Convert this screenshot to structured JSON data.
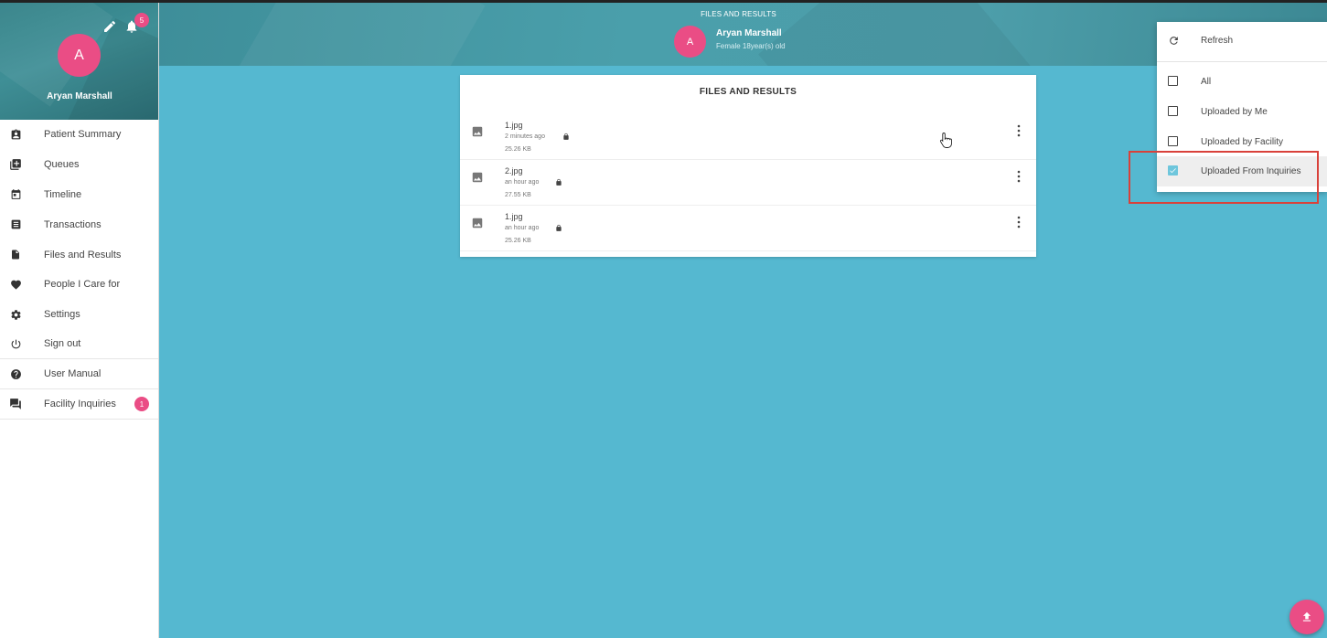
{
  "header": {
    "title": "FILES AND RESULTS",
    "avatar_letter": "A",
    "patient_name": "Aryan Marshall",
    "patient_info": "Female 18year(s) old"
  },
  "sidebar": {
    "avatar_letter": "A",
    "user_name": "Aryan Marshall",
    "notification_count": "5",
    "items": [
      {
        "label": "Patient Summary",
        "icon": "clipboard-user-icon"
      },
      {
        "label": "Queues",
        "icon": "queue-add-icon"
      },
      {
        "label": "Timeline",
        "icon": "calendar-icon"
      },
      {
        "label": "Transactions",
        "icon": "list-icon"
      },
      {
        "label": "Files and Results",
        "icon": "file-icon"
      },
      {
        "label": "People I Care for",
        "icon": "heart-icon"
      },
      {
        "label": "Settings",
        "icon": "gear-icon"
      },
      {
        "label": "Sign out",
        "icon": "power-icon"
      },
      {
        "label": "User Manual",
        "icon": "help-icon"
      },
      {
        "label": "Facility Inquiries",
        "icon": "chat-icon",
        "badge": "1"
      }
    ]
  },
  "card": {
    "title": "FILES AND RESULTS",
    "files": [
      {
        "name": "1.jpg",
        "time": "2 minutes ago",
        "size": "25.26 KB"
      },
      {
        "name": "2.jpg",
        "time": "an hour ago",
        "size": "27.55 KB"
      },
      {
        "name": "1.jpg",
        "time": "an hour ago",
        "size": "25.26 KB"
      }
    ]
  },
  "menu": {
    "refresh_label": "Refresh",
    "options": [
      {
        "label": "All",
        "checked": false
      },
      {
        "label": "Uploaded by Me",
        "checked": false
      },
      {
        "label": "Uploaded by Facility",
        "checked": false
      },
      {
        "label": "Uploaded From Inquiries",
        "checked": true
      }
    ]
  },
  "colors": {
    "background": "#55b8d0",
    "accent_pink": "#ea4d85",
    "header_teal": "#4a9fab",
    "check_blue": "#6ec6dc",
    "highlight_red": "#d9413a"
  }
}
